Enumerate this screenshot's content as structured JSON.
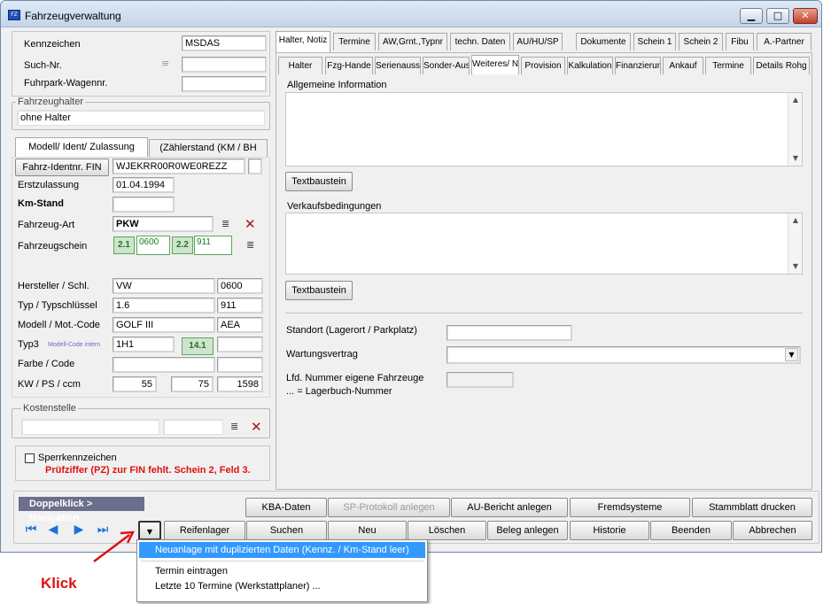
{
  "window": {
    "title": "Fahrzeugverwaltung",
    "icon": "app-icon",
    "controls": {
      "minimize": "▁",
      "maximize": "□",
      "close": "✕"
    }
  },
  "left": {
    "kennzeichen_label": "Kennzeichen",
    "kennzeichen_value": "MSDAS",
    "suchnr_label": "Such-Nr.",
    "suchnr_value": "",
    "fuhrpark_label": "Fuhrpark-Wagennr.",
    "fuhrpark_value": "",
    "halter_group": "Fahrzeughalter",
    "halter_value": "ohne Halter",
    "tabs": [
      "Modell/ Ident/ Zulassung",
      "(Zählerstand (KM / BH"
    ],
    "fin_button": "Fahrz-Identnr. FIN",
    "fin_value": "WJEKRR00R0WE0REZZ",
    "erstzulassung_label": "Erstzulassung",
    "erstzulassung_value": "01.04.1994",
    "kmstand_label": "Km-Stand",
    "kmstand_value": "",
    "fahrzeugart_label": "Fahrzeug-Art",
    "fahrzeugart_value": "PKW",
    "fahrzeugschein_label": "Fahrzeugschein",
    "schein": {
      "l1": "2.1",
      "v1": "0600",
      "l2": "2.2",
      "v2": "911"
    },
    "hersteller_label": "Hersteller / Schl.",
    "hersteller_value": "VW",
    "hersteller_key": "0600",
    "typ_label": "Typ / Typschlüssel",
    "typ_value": "1.6",
    "typ_key": "911",
    "modell_label": "Modell / Mot.-Code",
    "modell_value": "GOLF III",
    "modell_code": "AEA",
    "typ3_label": "Typ3",
    "typ3_hint": "Modell-Code intern",
    "typ3_value": "1H1",
    "typ3_green": "14.1",
    "farbe_label": "Farbe / Code",
    "kw_label": "KW / PS / ccm",
    "kw": "55",
    "ps": "75",
    "ccm": "1598",
    "kostenstelle_group": "Kostenstelle",
    "sperr_label": "Sperrkennzeichen",
    "warning": "Prüfziffer (PZ) zur FIN fehlt. Schein 2, Feld 3."
  },
  "right": {
    "tabs_row1": [
      "Halter, Notiz",
      "Termine",
      "AW,Grnt.,Typnr",
      "techn. Daten",
      "AU/HU/SP",
      "Dokumente",
      "Schein 1",
      "Schein 2",
      "Fibu",
      "A.-Partner"
    ],
    "tabs_row2": [
      "Halter",
      "Fzg-Hande",
      "Serienauss",
      "Sonder-Aus",
      "Weiteres/ N",
      "Provision",
      "Kalkulation",
      "Finanzierun",
      "Ankauf",
      "Termine",
      "Details Rohg"
    ],
    "allg_label": "Allgemeine Information",
    "textbaustein": "Textbaustein",
    "verkauf_label": "Verkaufsbedingungen",
    "standort_label": "Standort (Lagerort / Parkplatz)",
    "wartung_label": "Wartungsvertrag",
    "lfd_label1": "Lfd. Nummer eigene Fahrzeuge",
    "lfd_label2": "... = Lagerbuch-Nummer"
  },
  "bottom": {
    "nav_label": "Doppelklick > Navigation",
    "row1": [
      "KBA-Daten",
      "SP-Protokoll anlegen",
      "AU-Bericht anlegen",
      "Fremdsysteme",
      "Stammblatt drucken"
    ],
    "row2": [
      "Reifenlager",
      "Suchen",
      "Neu",
      "Löschen",
      "Beleg anlegen",
      "Historie",
      "Beenden",
      "Abbrechen"
    ]
  },
  "menu": {
    "items": [
      "Neuanlage mit duplizierten Daten (Kennz. / Km-Stand leer)",
      "Termin eintragen",
      "Letzte 10 Termine (Werkstattplaner) ..."
    ]
  },
  "annotation": {
    "text": "Klick",
    "color": "#e01010"
  },
  "colors": {
    "accent": "#3399ff",
    "warning": "#e01010",
    "green": "#1a7a1a"
  }
}
